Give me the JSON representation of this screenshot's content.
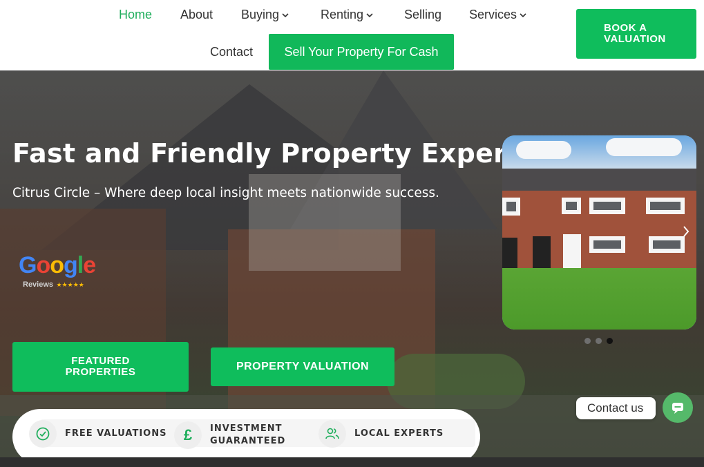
{
  "nav": {
    "home": "Home",
    "about": "About",
    "buying": "Buying",
    "renting": "Renting",
    "selling": "Selling",
    "services": "Services",
    "contact": "Contact",
    "cash": "Sell Your Property For Cash"
  },
  "book": {
    "line1": "BOOK A",
    "line2": "VALUATION"
  },
  "hero": {
    "title": "Fast and Friendly Property Experts",
    "subtitle": "Citrus Circle – Where deep local insight meets nationwide success."
  },
  "google": {
    "g1": "G",
    "o1": "o",
    "o2": "o",
    "g2": "g",
    "l": "l",
    "e": "e",
    "reviews": "Reviews",
    "stars": "★★★★★"
  },
  "buttons": {
    "featured_line1": "FEATURED",
    "featured_line2": "PROPERTIES",
    "valuation": "PROPERTY VALUATION"
  },
  "features": [
    {
      "label": "FREE VALUATIONS",
      "icon": "check-circle-icon"
    },
    {
      "line1": "INVESTMENT",
      "line2": "GUARANTEED",
      "icon": "pound-icon",
      "glyph": "£"
    },
    {
      "label": "LOCAL EXPERTS",
      "icon": "users-icon"
    }
  ],
  "slider": {
    "total_dots": 3,
    "active_dot": 3
  },
  "contact": {
    "label": "Contact us"
  },
  "colors": {
    "brand_green": "#0fbd5c",
    "active_nav": "#1fae5c"
  }
}
